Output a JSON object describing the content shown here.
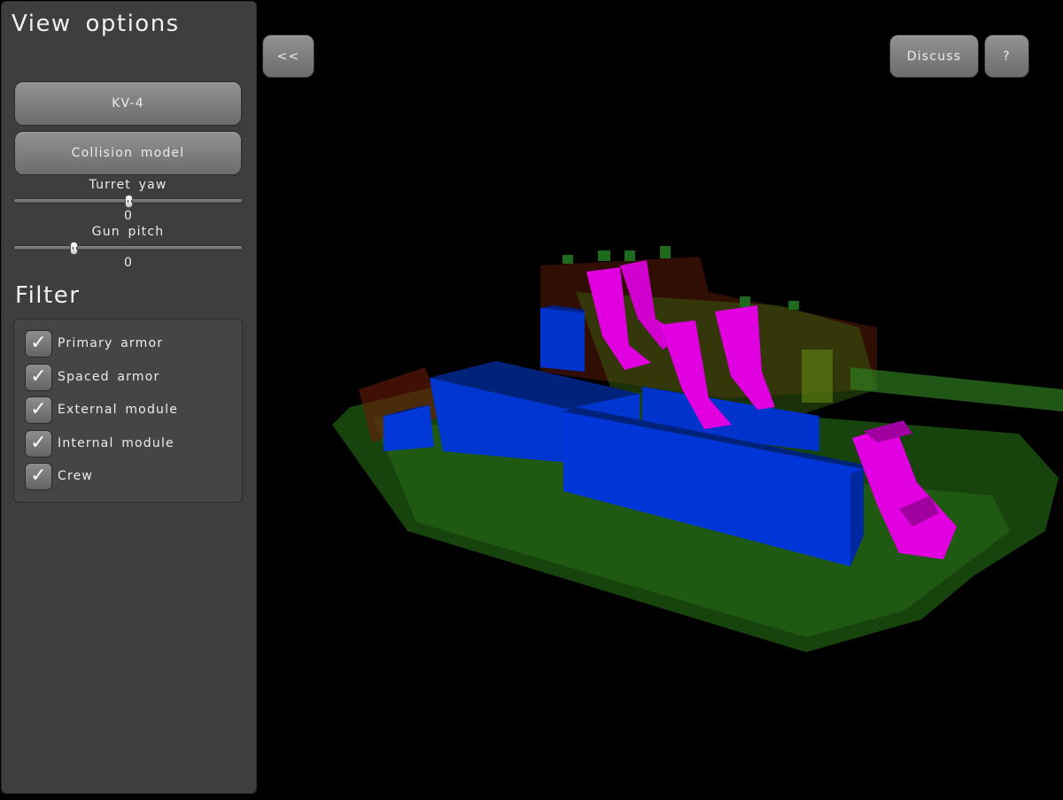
{
  "panel": {
    "title": "View options",
    "vehicle_button": "KV-4",
    "model_button": "Collision model",
    "sliders": [
      {
        "label": "Turret yaw",
        "value": "0",
        "position_fraction": 0.5
      },
      {
        "label": "Gun pitch",
        "value": "0",
        "position_fraction": 0.26
      }
    ],
    "filter": {
      "title": "Filter",
      "items": [
        {
          "label": "Primary armor",
          "checked": true
        },
        {
          "label": "Spaced armor",
          "checked": true
        },
        {
          "label": "External module",
          "checked": true
        },
        {
          "label": "Internal module",
          "checked": true
        },
        {
          "label": "Crew",
          "checked": true
        }
      ]
    }
  },
  "toolbar": {
    "back_label": "<<",
    "discuss_label": "Discuss",
    "help_label": "?"
  },
  "check_glyph": "✓",
  "viewport": {
    "description": "3D collision model of tank",
    "colors": {
      "internal_module": "#0033cc",
      "crew": "#e000e0",
      "primary_armor": "#2a8a1a",
      "spaced_armor": "#8a1a0a"
    }
  }
}
